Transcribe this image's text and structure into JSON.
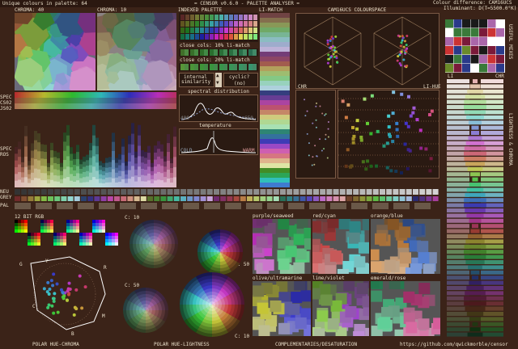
{
  "header": {
    "left": "Unique colours in palette: 64",
    "center": "= CENSOR v0.6.0 - PALETTE ANALYSER =",
    "right1": "Colour difference: CAM16UCS",
    "right2": "Illuminant: D(T=5500.0°K)"
  },
  "labels": {
    "chroma40": "CHROMA: 40",
    "chroma10": "CHROMA: 10",
    "indexed": "INDEXED PALETTE",
    "limatch": "LI-MATCH",
    "cam16": "CAM16UCS COLOURSPACE",
    "useful": "USEFUL MIXES",
    "close10": "close cols: 10% li-match",
    "close20": "close cols: 20% li-match",
    "internal": "internal",
    "similarity": "similarity",
    "cyclic": "cyclic?",
    "no": "(no)",
    "spectral": "spectral distribution",
    "s400": "400",
    "s650": "650",
    "temperature": "temperature",
    "cold": "COLD",
    "warm": "WARM",
    "spec": "SPEC",
    "cs02": "CS02",
    "js02": "JS02",
    "spec2": "SPEC",
    "ros": "ROS",
    "chr": "CHR",
    "lihue": "LI-HUE",
    "li": "LI",
    "chr2": "CHR",
    "lightness_chroma": "LIGHTNESS & CHROMA",
    "neu": "NEU",
    "grey": "GREY",
    "pal": "PAL",
    "bit12": "12 BIT RGB",
    "c10a": "C: 10",
    "c50a": "C: 50",
    "c50b": "C: 50",
    "c10b": "C: 10",
    "purple_seaweed": "purple/seaweed",
    "red_cyan": "red/cyan",
    "orange_blue": "orange/blue",
    "olive_ultramarine": "olive/ultramarine",
    "lime_violet": "lime/violet",
    "emerald_rose": "emerald/rose",
    "g": "G",
    "y": "Y",
    "r": "R",
    "c": "C",
    "m": "M",
    "b": "B",
    "polar_hc": "POLAR HUE-CHROMA",
    "polar_hl": "POLAR HUE-LIGHTNESS",
    "comp": "COMPLEMENTARIES/DESATURATION",
    "url": "https://github.com/qwickmorble/censor"
  },
  "colors": {
    "background": "#3b2318",
    "panel": "#2a1a12",
    "accent": "#e9dcc8"
  }
}
